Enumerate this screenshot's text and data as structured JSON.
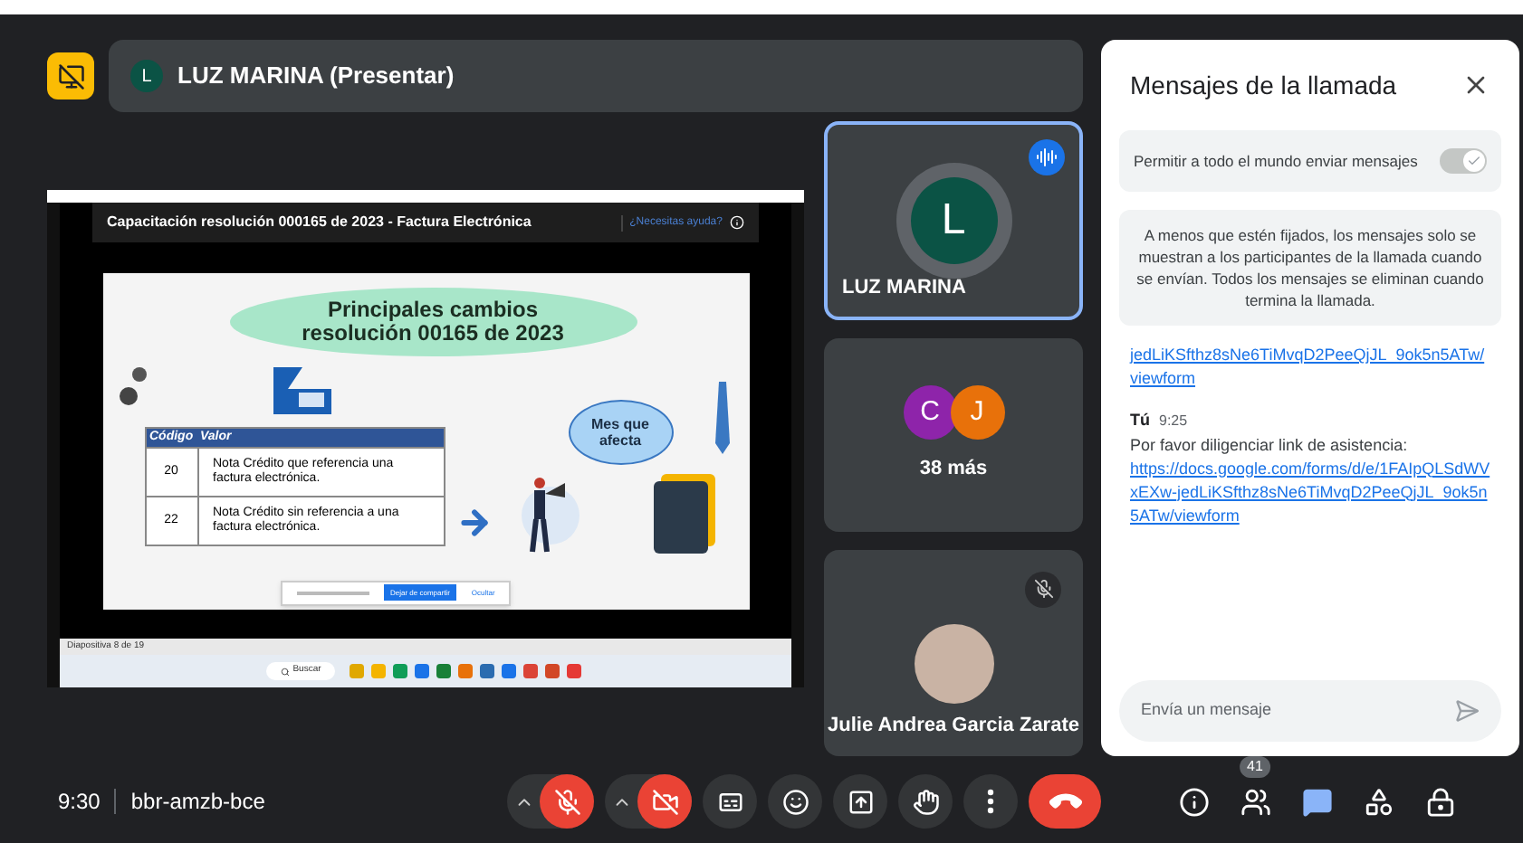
{
  "presenter": {
    "initial": "L",
    "label": "LUZ MARINA (Presentar)"
  },
  "shared_screen": {
    "header_title": "Capacitación resolución 000165 de 2023 - Factura Electrónica",
    "help_link": "¿Necesitas ayuda?",
    "slide": {
      "title": "Principales cambios resolución 00165 de 2023",
      "columns": [
        "Código",
        "Valor"
      ],
      "rows": [
        {
          "code": "20",
          "value": "Nota Crédito que referencia una factura electrónica."
        },
        {
          "code": "22",
          "value": "Nota Crédito sin referencia a una factura electrónica."
        }
      ],
      "bubble": "Mes que afecta"
    },
    "share_notice": {
      "stop_button": "Dejar de compartir",
      "hide_link": "Ocultar"
    },
    "status": "Diapositiva 8 de 19",
    "taskbar_search": "Buscar"
  },
  "tiles": [
    {
      "kind": "avatar",
      "initial": "L",
      "name": "LUZ MARINA",
      "speaking": true
    },
    {
      "kind": "group",
      "avatars": [
        {
          "initial": "C",
          "color": "#8e24aa"
        },
        {
          "initial": "J",
          "color": "#e8710a"
        }
      ],
      "label": "38 más"
    },
    {
      "kind": "photo",
      "name": "Julie Andrea Garcia Zarate",
      "muted": true
    }
  ],
  "chat": {
    "title": "Mensajes de la llamada",
    "toggle": {
      "label": "Permitir a todo el mundo enviar mensajes",
      "on": true
    },
    "notice": "A menos que estén fijados, los mensajes solo se muestran a los participantes de la llamada cuando se envían. Todos los mensajes se eliminan cuando termina la llamada.",
    "messages": [
      {
        "kind": "partial",
        "link": "jedLiKSfthz8sNe6TiMvqD2PeeQjJL_9ok5n5ATw/viewform"
      },
      {
        "kind": "full",
        "sender": "Tú",
        "time": "9:25",
        "text": "Por favor diligenciar link de asistencia:",
        "link": "https://docs.google.com/forms/d/e/1FAIpQLSdWVxEXw-jedLiKSfthz8sNe6TiMvqD2PeeQjJL_9ok5n5ATw/viewform"
      }
    ],
    "input_placeholder": "Envía un mensaje"
  },
  "bottom_bar": {
    "time": "9:30",
    "meeting_code": "bbr-amzb-bce",
    "controls": [
      {
        "kind": "mic",
        "on": false
      },
      {
        "kind": "camera",
        "on": false
      },
      {
        "kind": "captions",
        "on": false
      },
      {
        "kind": "emoji"
      },
      {
        "kind": "present"
      },
      {
        "kind": "hand"
      },
      {
        "kind": "more"
      },
      {
        "kind": "end"
      }
    ],
    "side": [
      {
        "kind": "info",
        "selected": false
      },
      {
        "kind": "people",
        "badge": "41",
        "selected": false
      },
      {
        "kind": "chat",
        "selected": true
      },
      {
        "kind": "activities",
        "selected": false
      },
      {
        "kind": "lock",
        "selected": false
      }
    ]
  }
}
